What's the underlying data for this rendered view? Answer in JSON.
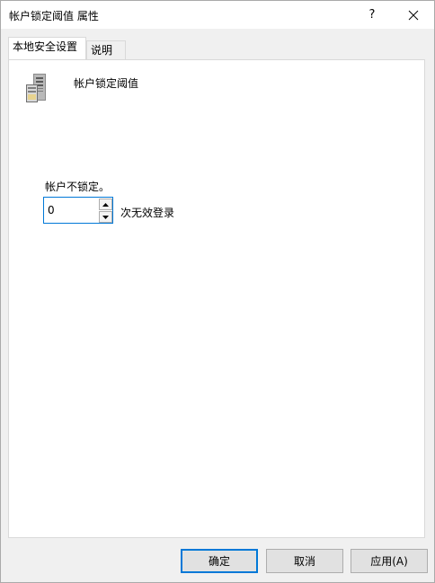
{
  "window": {
    "title": "帐户锁定阈值 属性",
    "help_label": "?",
    "close_icon": "close-icon"
  },
  "tabs": [
    {
      "label": "本地安全设置",
      "active": true
    },
    {
      "label": "说明",
      "active": false
    }
  ],
  "policy": {
    "icon": "server-icon",
    "name": "帐户锁定阈值"
  },
  "threshold": {
    "status_text": "帐户不锁定。",
    "value": "0",
    "unit_label": "次无效登录"
  },
  "buttons": {
    "ok": "确定",
    "cancel": "取消",
    "apply": "应用(A)"
  },
  "colors": {
    "accent": "#0078d7",
    "window_bg": "#f0f0f0",
    "panel_bg": "#ffffff"
  }
}
